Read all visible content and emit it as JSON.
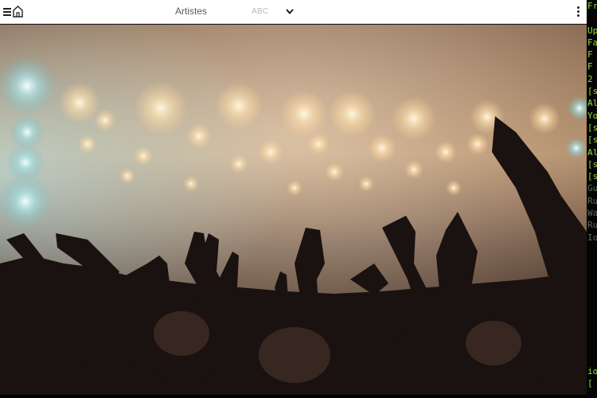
{
  "header": {
    "title": "Artistes",
    "sort_label": "ABC",
    "icons": [
      "menu-icon",
      "home-icon",
      "chevron-down-icon",
      "more-vertical-icon"
    ]
  },
  "colors": {
    "header_bg": "#ffffff",
    "terminal_text": "#8ae234",
    "terminal_dim": "#5a6a58"
  },
  "terminal": {
    "lines": [
      {
        "text": "Fr",
        "tone": "green"
      },
      {
        "text": "",
        "tone": "green"
      },
      {
        "text": "Up",
        "tone": "green"
      },
      {
        "text": "Fa",
        "tone": "green"
      },
      {
        "text": " F",
        "tone": "green"
      },
      {
        "text": " F",
        "tone": "green"
      },
      {
        "text": " 2",
        "tone": "green"
      },
      {
        "text": "[s",
        "tone": "green"
      },
      {
        "text": "Al",
        "tone": "green"
      },
      {
        "text": "Yo",
        "tone": "green"
      },
      {
        "text": "[s",
        "tone": "green"
      },
      {
        "text": "[s",
        "tone": "green"
      },
      {
        "text": "Al",
        "tone": "green"
      },
      {
        "text": "[s",
        "tone": "green"
      },
      {
        "text": "[s",
        "tone": "green"
      },
      {
        "text": "Gu",
        "tone": "dim"
      },
      {
        "text": "Ru",
        "tone": "dim"
      },
      {
        "text": "Wa",
        "tone": "dim"
      },
      {
        "text": "Ru",
        "tone": "dim"
      },
      {
        "text": "Io",
        "tone": "dim"
      },
      {
        "text": "",
        "tone": "dim"
      },
      {
        "text": "",
        "tone": "dim"
      },
      {
        "text": "",
        "tone": "dim"
      },
      {
        "text": "",
        "tone": "dim"
      },
      {
        "text": "",
        "tone": "dim"
      },
      {
        "text": "",
        "tone": "dim"
      },
      {
        "text": "",
        "tone": "dim"
      },
      {
        "text": "",
        "tone": "dim"
      },
      {
        "text": "",
        "tone": "dim"
      },
      {
        "text": "",
        "tone": "dim"
      },
      {
        "text": "io",
        "tone": "green"
      },
      {
        "text": "[",
        "tone": "green"
      }
    ]
  }
}
